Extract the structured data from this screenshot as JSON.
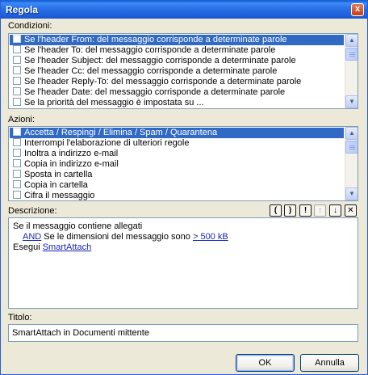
{
  "window": {
    "title": "Regola",
    "close_glyph": "x"
  },
  "conditions": {
    "label": "Condizioni:",
    "items": [
      {
        "label": "Se l'header From: del messaggio corrisponde a determinate parole",
        "selected": true,
        "checked": false
      },
      {
        "label": "Se l'header To: del messaggio corrisponde a determinate parole",
        "selected": false,
        "checked": false
      },
      {
        "label": "Se l'header Subject: del messaggio corrisponde a determinate parole",
        "selected": false,
        "checked": false
      },
      {
        "label": "Se l'header Cc: del messaggio corrisponde a determinate parole",
        "selected": false,
        "checked": false
      },
      {
        "label": "Se l'header Reply-To: del messaggio corrisponde a determinate parole",
        "selected": false,
        "checked": false
      },
      {
        "label": "Se l'header Date: del messaggio corrisponde a determinate parole",
        "selected": false,
        "checked": false
      },
      {
        "label": "Se la priorità del messaggio è impostata su ...",
        "selected": false,
        "checked": false
      }
    ]
  },
  "actions": {
    "label": "Azioni:",
    "items": [
      {
        "label": "Accetta / Respingi / Elimina / Spam / Quarantena",
        "selected": true,
        "checked": false
      },
      {
        "label": "Interrompi l'elaborazione di ulteriori regole",
        "selected": false,
        "checked": false
      },
      {
        "label": "Inoltra a indirizzo e-mail",
        "selected": false,
        "checked": false
      },
      {
        "label": "Copia in indirizzo e-mail",
        "selected": false,
        "checked": false
      },
      {
        "label": "Sposta in cartella",
        "selected": false,
        "checked": false
      },
      {
        "label": "Copia in cartella",
        "selected": false,
        "checked": false
      },
      {
        "label": "Cifra il messaggio",
        "selected": false,
        "checked": false
      }
    ]
  },
  "description": {
    "label": "Descrizione:",
    "toolbar": {
      "open_paren": "(",
      "close_paren": ")",
      "not": "!",
      "move_up": "↑",
      "move_down": "↓",
      "delete": "✕"
    },
    "line1": "Se il messaggio contiene allegati",
    "line2_and": "AND",
    "line2_text": " Se le dimensioni del messaggio sono ",
    "line2_value": "> 500 kB",
    "line3_text": "Esegui ",
    "line3_link": "SmartAttach"
  },
  "title_field": {
    "label": "Titolo:",
    "value": "SmartAttach in Documenti mittente"
  },
  "buttons": {
    "ok": "OK",
    "cancel": "Annulla"
  },
  "colors": {
    "selection": "#316ac5",
    "link": "#1a26b8",
    "dialog_bg": "#ece9d8"
  }
}
